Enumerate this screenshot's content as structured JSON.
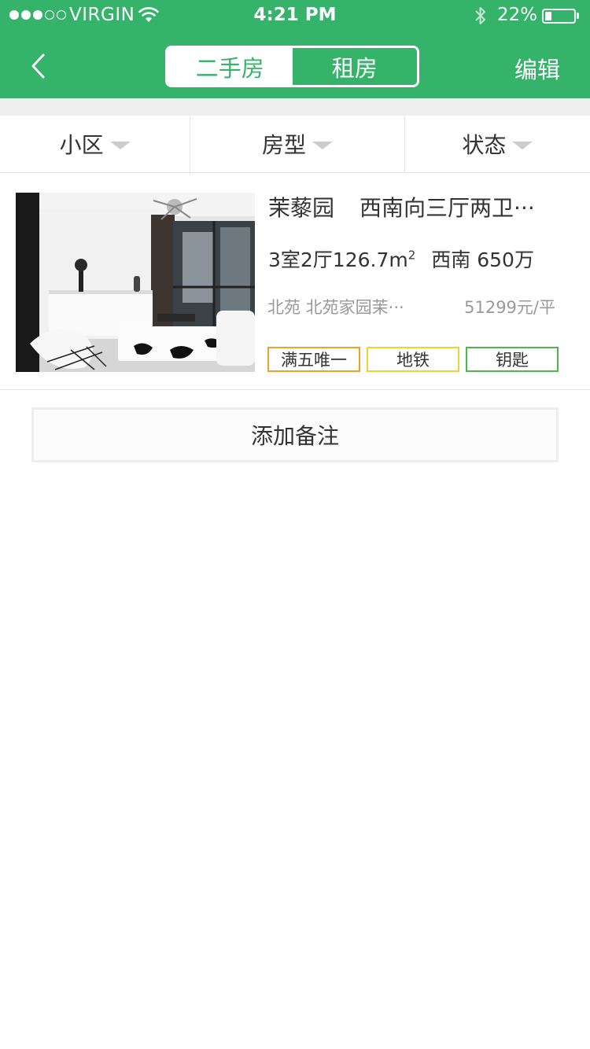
{
  "status_bar": {
    "carrier": "VIRGIN",
    "time": "4:21 PM",
    "battery_percent": "22%",
    "battery_level": 0.22,
    "signal_bars": 3,
    "signal_total": 5
  },
  "nav": {
    "back_icon": "chevron-left-icon",
    "tabs": [
      {
        "label": "二手房",
        "active": false
      },
      {
        "label": "租房",
        "active": true
      }
    ],
    "edit_label": "编辑"
  },
  "filters": [
    {
      "label": "小区",
      "icon": "dropdown-caret-icon"
    },
    {
      "label": "房型",
      "icon": "dropdown-caret-icon"
    },
    {
      "label": "状态",
      "icon": "dropdown-caret-icon"
    }
  ],
  "listing": {
    "community": "茉藜园",
    "headline": "西南向三厅两卫···",
    "layout": "3室2厅126.7m",
    "area_unit_sup": "2",
    "orientation_price": "西南 650万",
    "location": "北苑 北苑家园茉···",
    "unit_price": "51299元/平",
    "tags": [
      {
        "label": "满五唯一",
        "color": "#f0a226"
      },
      {
        "label": "地铁",
        "color": "#f2d22e"
      },
      {
        "label": "钥匙",
        "color": "#4cb84c"
      }
    ]
  },
  "add_note_label": "添加备注",
  "colors": {
    "brand_green": "#35b36a",
    "divider": "#e5e5e5",
    "muted_text": "#999999"
  }
}
